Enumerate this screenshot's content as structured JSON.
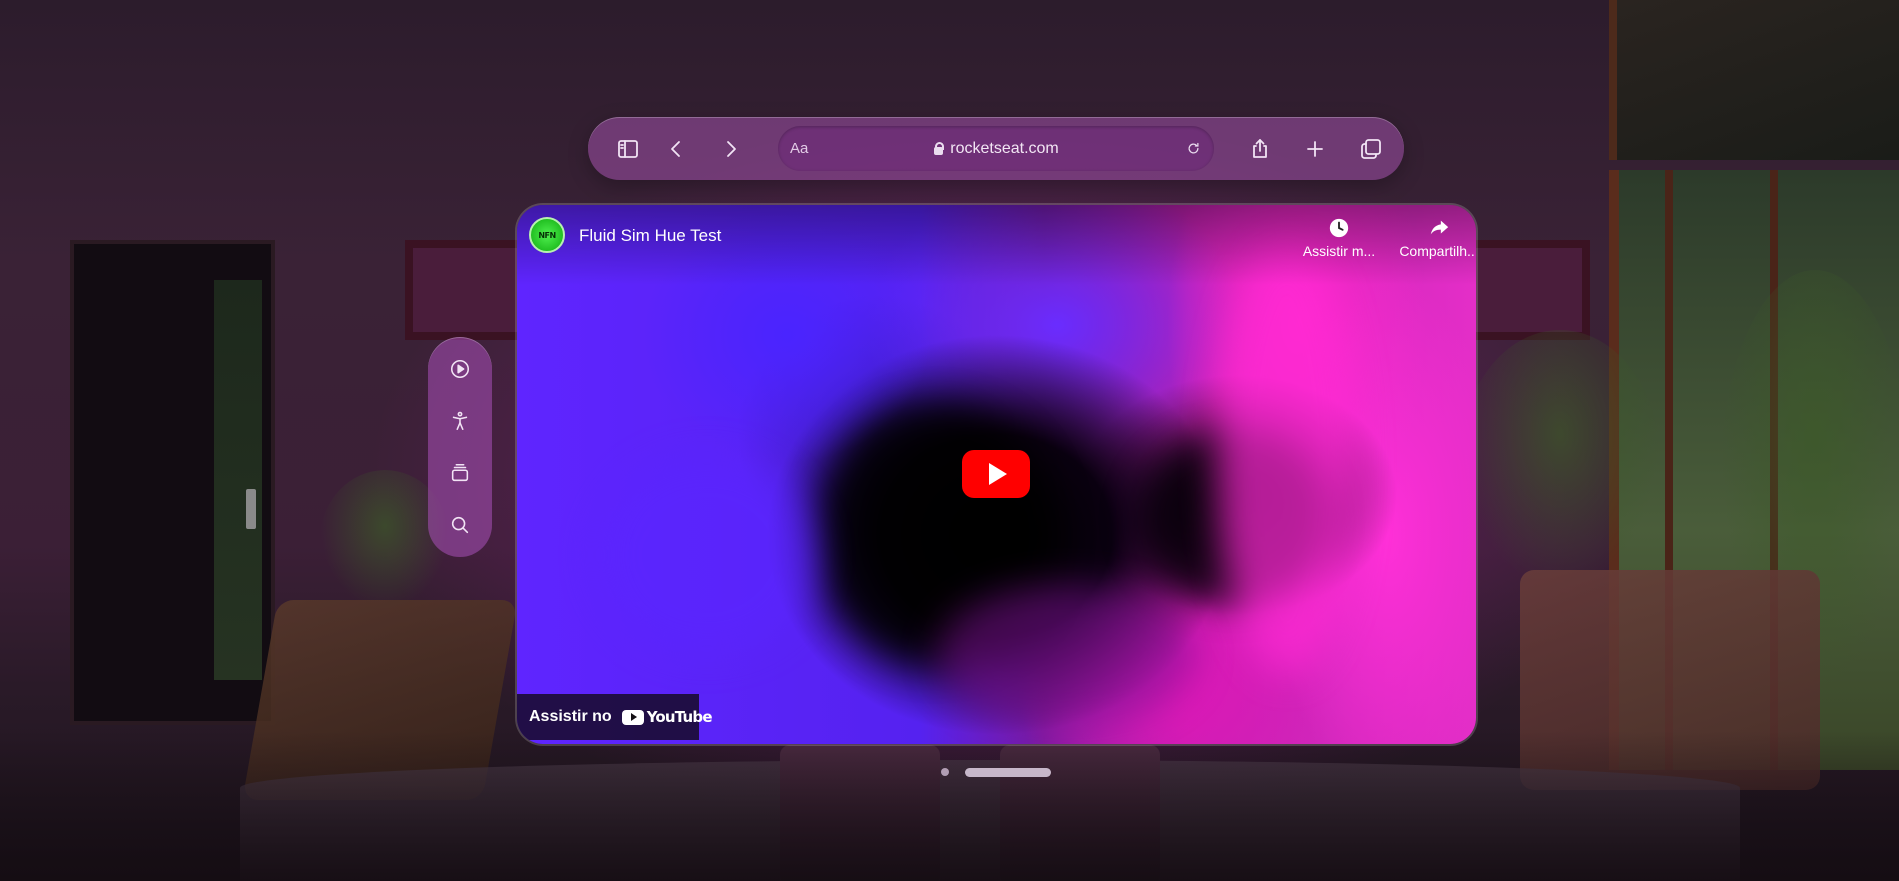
{
  "toolbar": {
    "sidebar_icon": "sidebar-icon",
    "back_icon": "chevron-left-icon",
    "forward_icon": "chevron-right-icon",
    "address": {
      "reader_label": "Aa",
      "url": "rocketseat.com",
      "lock_icon": "lock-icon",
      "reload_icon": "reload-icon"
    },
    "share_icon": "share-icon",
    "new_tab_icon": "plus-icon",
    "tabs_icon": "tabs-overview-icon"
  },
  "ornament": {
    "items": [
      "play-circle-icon",
      "accessibility-icon",
      "stack-icon",
      "search-icon"
    ]
  },
  "video": {
    "channel_avatar_text": "NFN",
    "title": "Fluid Sim Hue Test",
    "actions": [
      {
        "label": "Assistir m...",
        "icon": "clock-icon"
      },
      {
        "label": "Compartilh...",
        "icon": "share-arrow-icon"
      }
    ],
    "watch_on_label": "Assistir no",
    "youtube_logo_text": "YouTube",
    "play_icon": "play-icon"
  },
  "colors": {
    "accent": "#a050aa",
    "play_button": "#ff0000",
    "video_left": "#5f25ff",
    "video_right": "#e42ec8"
  }
}
